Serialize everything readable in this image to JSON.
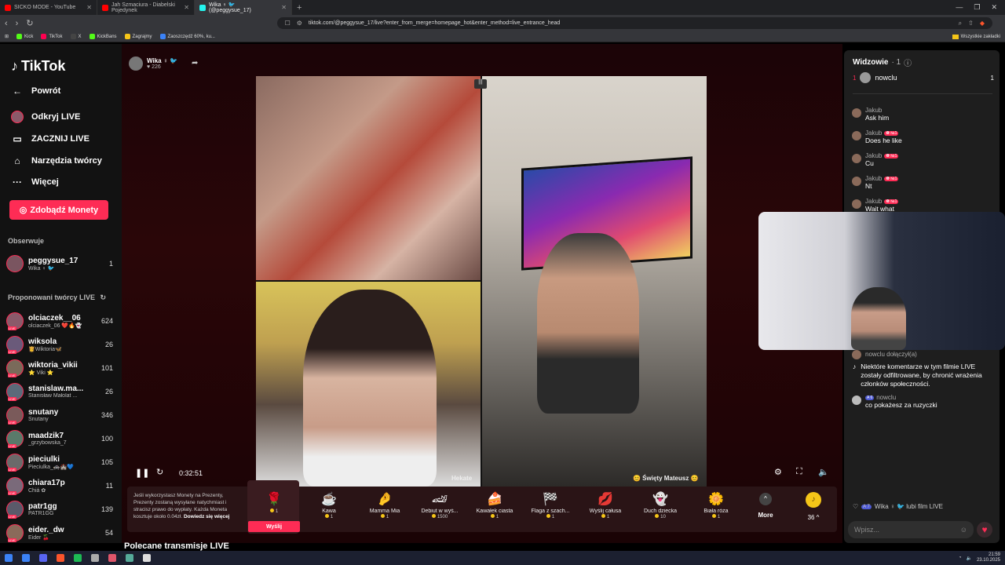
{
  "browser": {
    "tabs": [
      {
        "label": "SICKO MODE - YouTube",
        "color": "#ff0000"
      },
      {
        "label": "Jah Szmaciura - Diabelski Pojedynek",
        "color": "#ff0000"
      },
      {
        "label": "Wika ♀ 🐦 (@peggysue_17)",
        "color": "#25f4ee"
      }
    ],
    "url": "tiktok.com/@peggysue_17/live?enter_from_merge=homepage_hot&enter_method=live_entrance_head",
    "bookmarks": [
      "Kick",
      "TikTok",
      "X",
      "KickBans",
      "Zagrajmy",
      "Zaoszczędź 60%, ku..."
    ],
    "bookmarks_folder": "Wszystkie zakładki"
  },
  "sidebar": {
    "logo": "TikTok",
    "nav": [
      {
        "label": "Powrót",
        "icon": "arrow-left-icon"
      },
      {
        "label": "Odkryj LIVE",
        "icon": "live-avatar-icon"
      },
      {
        "label": "ZACZNIJ LIVE",
        "icon": "camera-icon"
      },
      {
        "label": "Narzędzia twórcy",
        "icon": "home-icon"
      },
      {
        "label": "Więcej",
        "icon": "more-icon"
      }
    ],
    "coins_button": "Zdobądź Monety",
    "following_title": "Obserwuje",
    "following": [
      {
        "name": "peggysue_17",
        "sub": "Wika ♀ 🐦",
        "count": "1"
      }
    ],
    "suggested_title": "Proponowani twórcy LIVE",
    "suggested": [
      {
        "name": "olciaczek__06",
        "sub": "olciaczek_06 ❤️🔥👻",
        "count": "624"
      },
      {
        "name": "wiksola",
        "sub": "👸Wiktoria🦋",
        "count": "26"
      },
      {
        "name": "wiktoria_vikii",
        "sub": "⭐ Viki ⭐",
        "count": "101"
      },
      {
        "name": "stanislaw.ma...",
        "sub": "Stanisław Małolat ...",
        "count": "26"
      },
      {
        "name": "snutany",
        "sub": "Snutany",
        "count": "346"
      },
      {
        "name": "maadzik7",
        "sub": "_grzybowska_7",
        "count": "100"
      },
      {
        "name": "pieciulki",
        "sub": "Pieciulka_🚓🏰💙",
        "count": "105"
      },
      {
        "name": "chiara17p",
        "sub": "Chiá ✿",
        "count": "11"
      },
      {
        "name": "patr1gg",
        "sub": "PATR1GG",
        "count": "139"
      },
      {
        "name": "eider._dw",
        "sub": "Eider 🍒",
        "count": "54"
      }
    ]
  },
  "stream": {
    "name": "Wika ♀ 🐦",
    "viewers": "♥ 226",
    "timer": "0:32:51",
    "labels": [
      "Hekate",
      "😊 Święty Mateusz 😊"
    ]
  },
  "gifts": {
    "info": "Jeśli wykorzystasz Monety na Prezenty, Prezenty zostaną wysyłane natychmiast i stracisz prawo do wypłaty. Każda Moneta kosztuje około 0.04zł.",
    "info_link": "Dowiedz się więcej",
    "send_label": "Wyślij",
    "items": [
      {
        "name": "",
        "price": "1",
        "icon": "🌹"
      },
      {
        "name": "Kawa",
        "price": "1",
        "icon": "☕"
      },
      {
        "name": "Mamma Mia",
        "price": "1",
        "icon": "🤌"
      },
      {
        "name": "Debiut w wyś...",
        "price": "1500",
        "icon": "🏎"
      },
      {
        "name": "Kawałek ciasta",
        "price": "1",
        "icon": "🍰"
      },
      {
        "name": "Flaga z szach...",
        "price": "1",
        "icon": "🏁"
      },
      {
        "name": "Wyślij całusa",
        "price": "1",
        "icon": "💋"
      },
      {
        "name": "Duch dziecka",
        "price": "10",
        "icon": "👻"
      },
      {
        "name": "Biała róża",
        "price": "1",
        "icon": "🌼"
      }
    ],
    "more_label": "More",
    "coin_balance": "36 ^"
  },
  "recommended_title": "Polecane transmisje LIVE",
  "chat": {
    "title": "Widzowie",
    "viewers_count": "· 1",
    "top_viewer": {
      "rank": "1",
      "name": "nowclu",
      "score": "1"
    },
    "messages": [
      {
        "user": "Jakub",
        "badge": "",
        "text": "Ask him"
      },
      {
        "user": "Jakub",
        "badge": "❻ №1",
        "text": "Does he like"
      },
      {
        "user": "Jakub",
        "badge": "❻ №1",
        "text": "Cu"
      },
      {
        "user": "Jakub",
        "badge": "❻ №1",
        "text": "Nt"
      },
      {
        "user": "Jakub",
        "badge": "❻ №1",
        "text": "Wait what"
      }
    ],
    "joined": "nowclu  dołączył(a)",
    "system": "Niektóre komentarze w tym filmie LIVE zostały odfiltrowane, by chronić wrażenia członków społeczności.",
    "last_msg": {
      "user": "nowclu",
      "badge": "A 6",
      "text": "co pokażesz za ruzyczki"
    },
    "like_user_badge": "A 7",
    "like_text": "Wika ♀ 🐦 lubi film LIVE",
    "input_placeholder": "Wpisz..."
  },
  "taskbar": {
    "time": "21:59",
    "date": "23.10.2025"
  },
  "colors": {
    "accent": "#fe2c55",
    "coin": "#f5c518"
  }
}
